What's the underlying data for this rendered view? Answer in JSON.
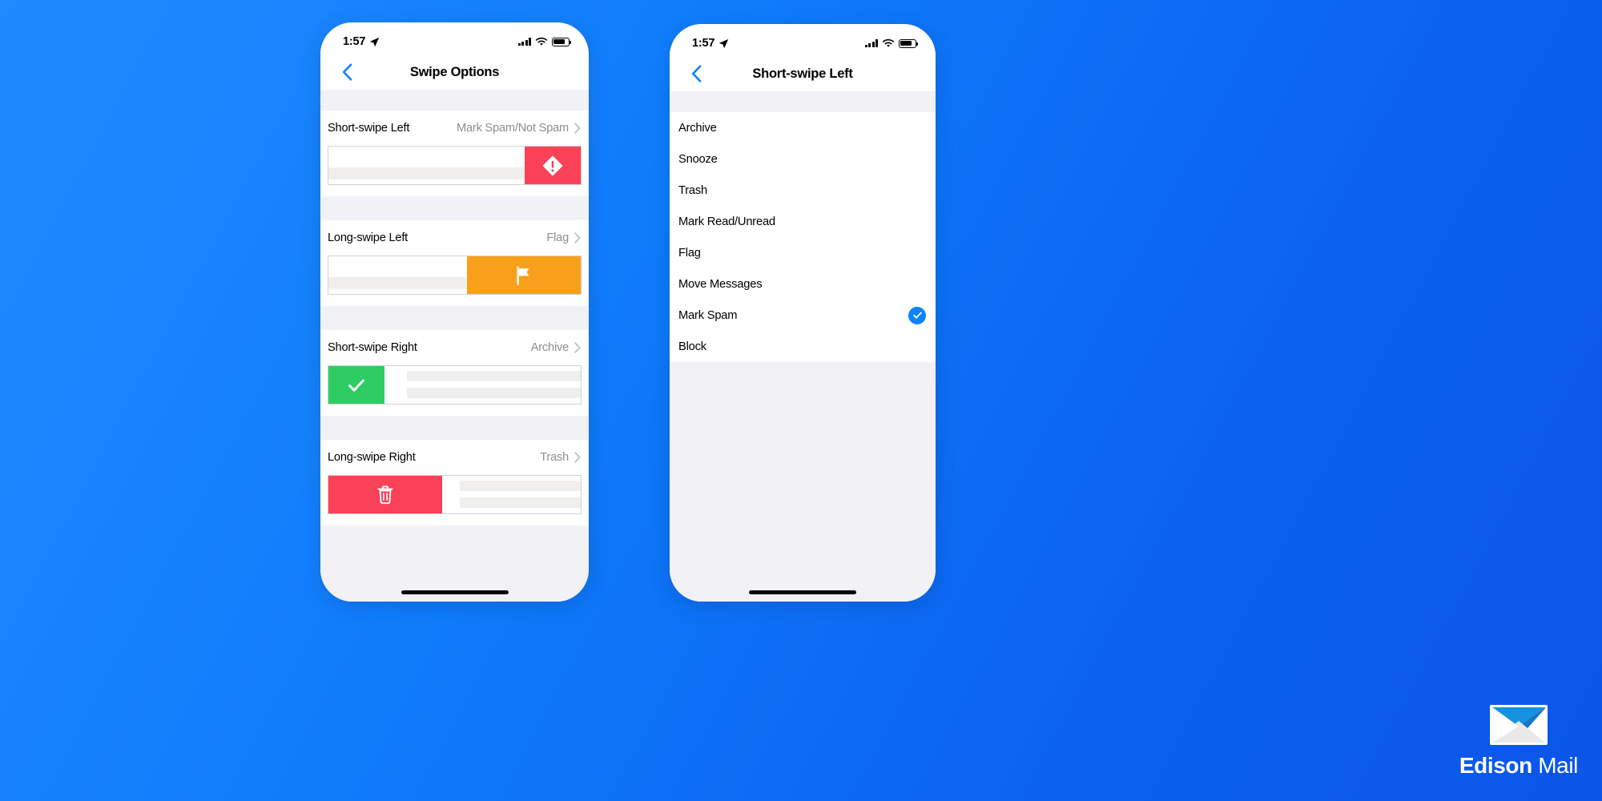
{
  "background_color": "#0c6ef4",
  "brand": {
    "name_bold": "Edison",
    "name_light": "Mail",
    "logo_icon": "envelope-icon"
  },
  "phone_left": {
    "status_bar": {
      "time": "1:57",
      "location_icon": "location-arrow-icon",
      "signal_icon": "cellular-bars-icon",
      "wifi_icon": "wifi-icon",
      "battery_icon": "battery-icon"
    },
    "nav": {
      "back_icon": "chevron-left-icon",
      "title": "Swipe Options"
    },
    "options": [
      {
        "title": "Short-swipe Left",
        "value": "Mark Spam/Not Spam",
        "chevron_icon": "chevron-right-icon",
        "preview": {
          "side": "right",
          "action_icon": "spam-exclamation-icon",
          "action_color": "#fb4158",
          "action_width": 70
        }
      },
      {
        "title": "Long-swipe Left",
        "value": "Flag",
        "chevron_icon": "chevron-right-icon",
        "preview": {
          "side": "right",
          "action_icon": "flag-icon",
          "action_color": "#f9a01b",
          "action_width": 142
        }
      },
      {
        "title": "Short-swipe Right",
        "value": "Archive",
        "chevron_icon": "chevron-right-icon",
        "preview": {
          "side": "left",
          "action_icon": "checkmark-icon",
          "action_color": "#2ecc63",
          "action_width": 70
        }
      },
      {
        "title": "Long-swipe Right",
        "value": "Trash",
        "chevron_icon": "chevron-right-icon",
        "preview": {
          "side": "left",
          "action_icon": "trash-icon",
          "action_color": "#fb4158",
          "action_width": 142
        }
      }
    ],
    "home_indicator": true
  },
  "phone_right": {
    "status_bar": {
      "time": "1:57",
      "location_icon": "location-arrow-icon",
      "signal_icon": "cellular-bars-icon",
      "wifi_icon": "wifi-icon",
      "battery_icon": "battery-icon"
    },
    "nav": {
      "back_icon": "chevron-left-icon",
      "title": "Short-swipe Left"
    },
    "choices": [
      {
        "label": "Archive",
        "selected": false
      },
      {
        "label": "Snooze",
        "selected": false
      },
      {
        "label": "Trash",
        "selected": false
      },
      {
        "label": "Mark Read/Unread",
        "selected": false
      },
      {
        "label": "Flag",
        "selected": false
      },
      {
        "label": "Move Messages",
        "selected": false
      },
      {
        "label": "Mark Spam",
        "selected": true
      },
      {
        "label": "Block",
        "selected": false
      }
    ],
    "selected_check_icon": "check-circle-icon",
    "accent_color": "#0b84fe",
    "home_indicator": true
  }
}
